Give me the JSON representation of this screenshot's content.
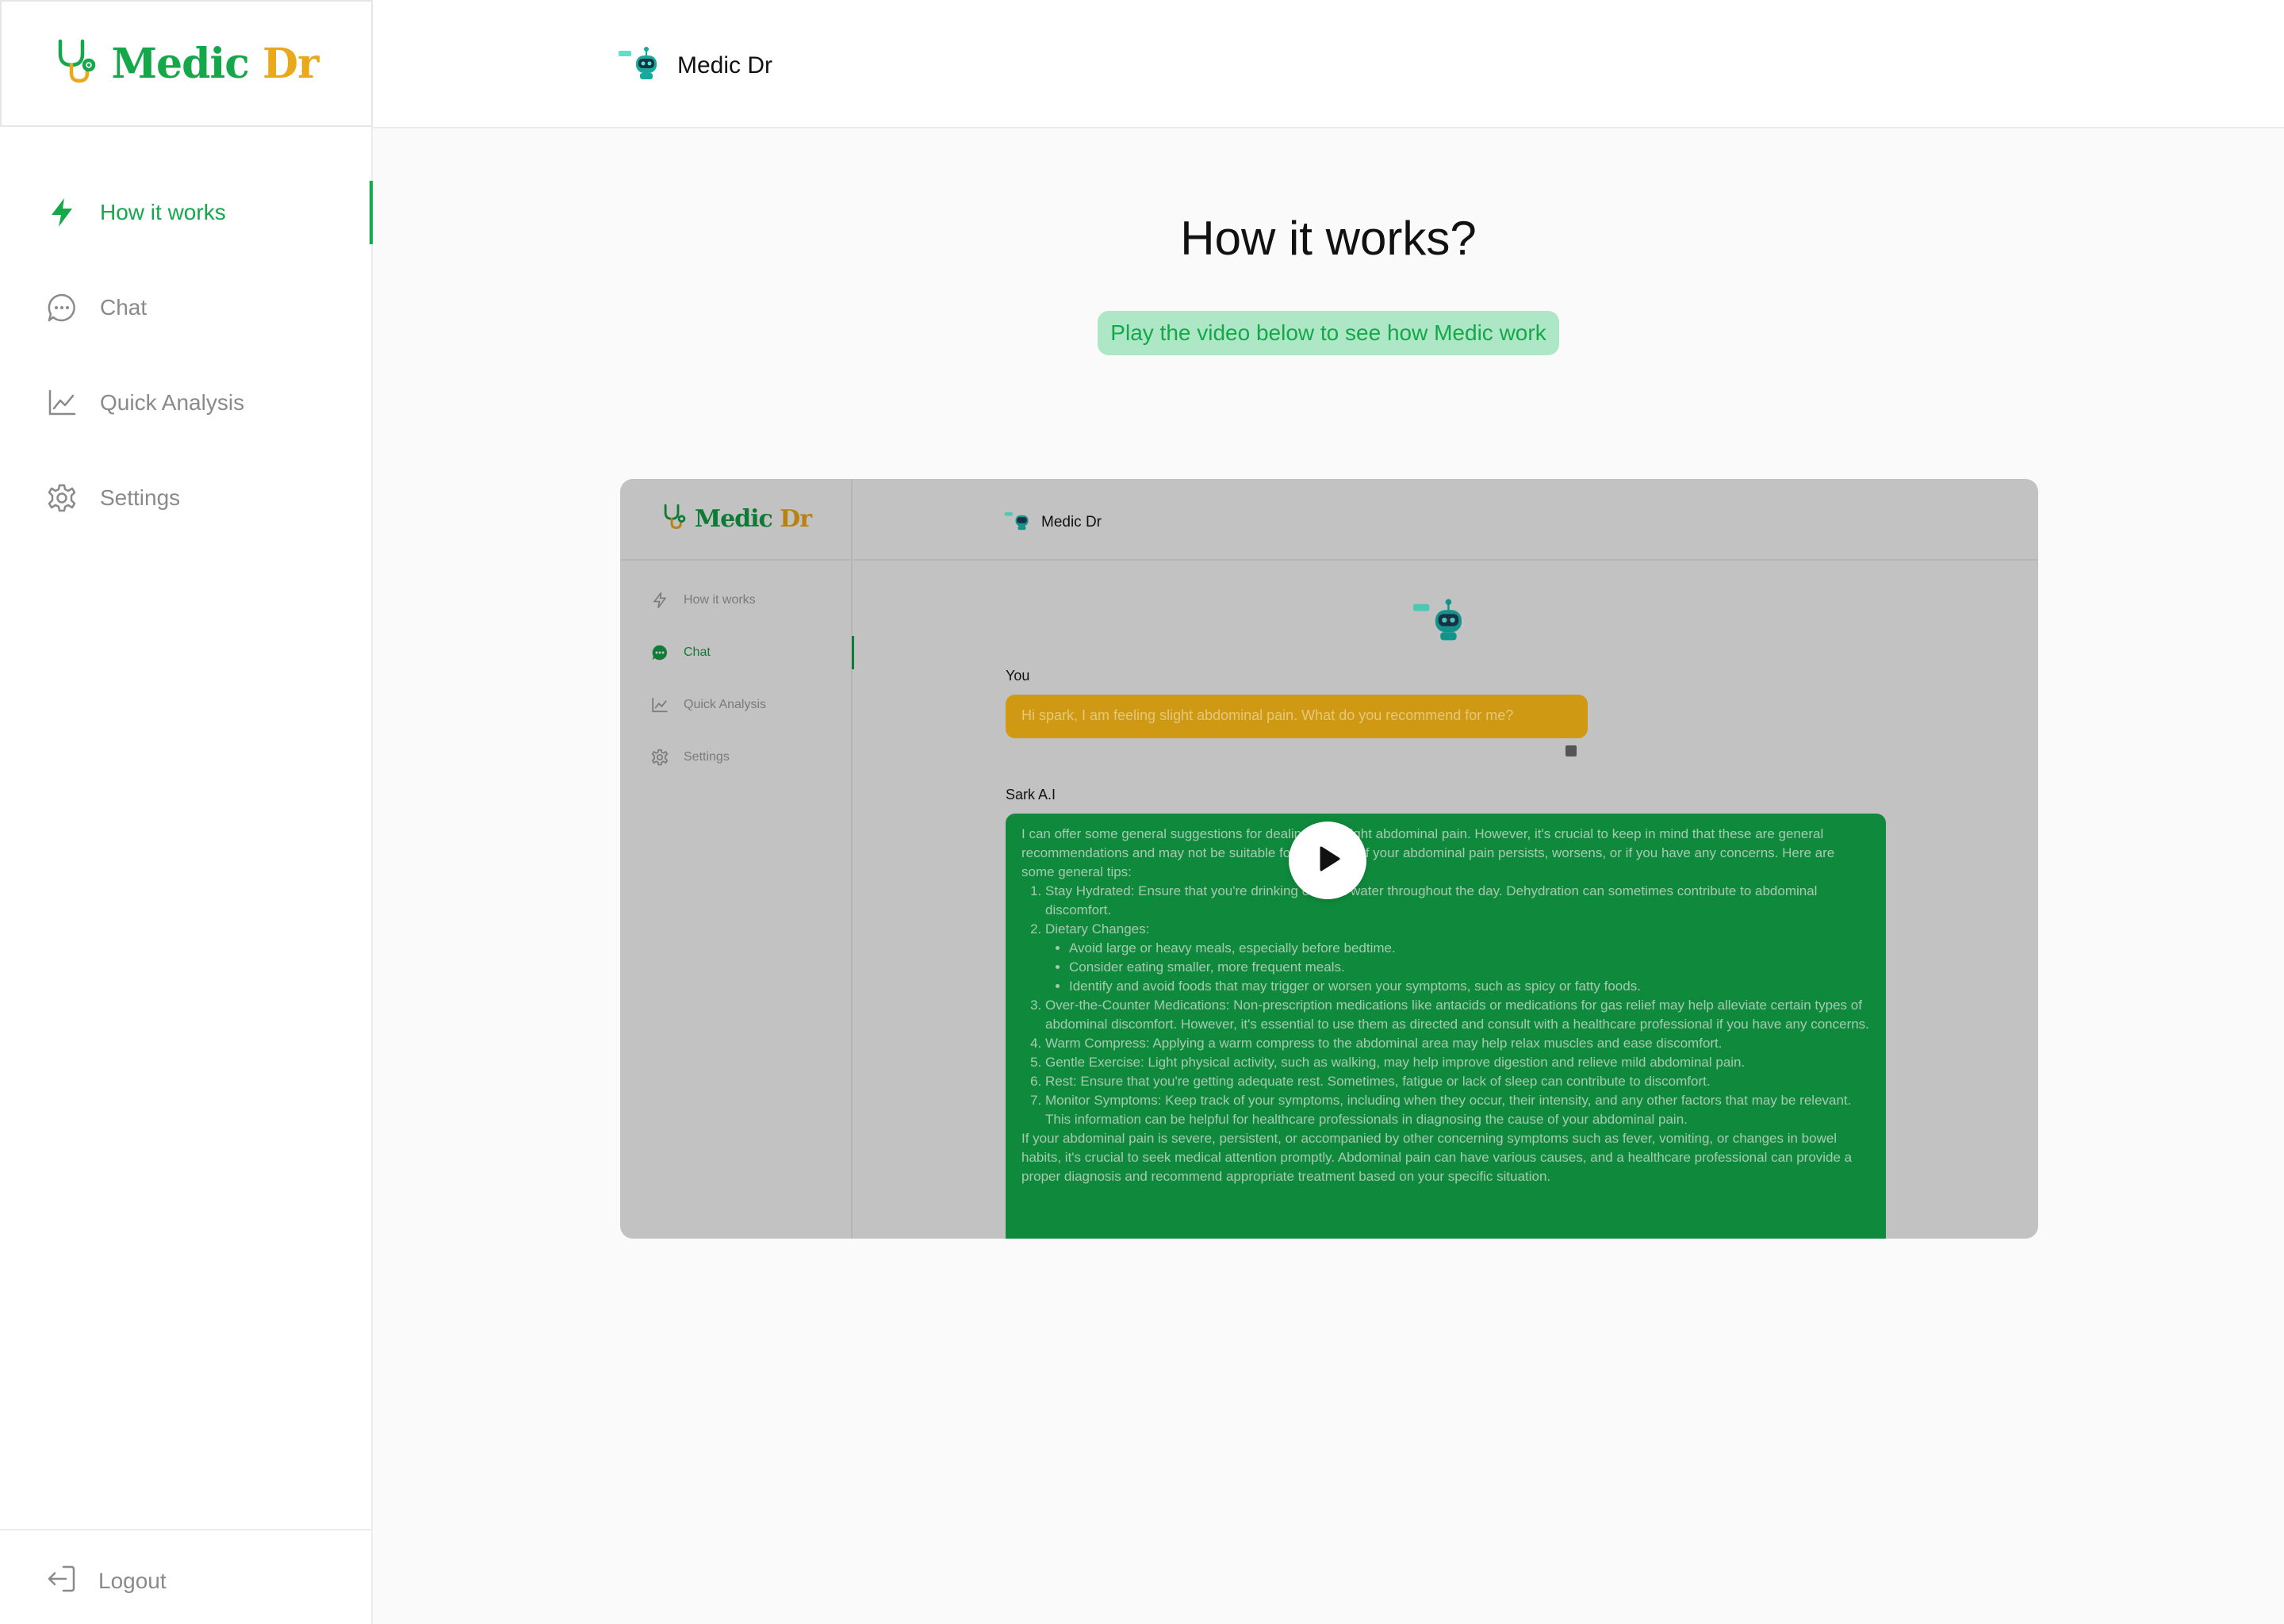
{
  "brand": {
    "part1": "Medic",
    "part2": "Dr",
    "header_name": "Medic Dr"
  },
  "sidebar": {
    "items": [
      {
        "label": "How it works",
        "icon": "lightning-icon",
        "active": true
      },
      {
        "label": "Chat",
        "icon": "chat-bubble-icon",
        "active": false
      },
      {
        "label": "Quick Analysis",
        "icon": "chart-line-icon",
        "active": false
      },
      {
        "label": "Settings",
        "icon": "gear-icon",
        "active": false
      }
    ],
    "logout_label": "Logout"
  },
  "main": {
    "title": "How it works?",
    "subtitle": "Play the video below to see how Medic work"
  },
  "video": {
    "sidebar_items": [
      "How it works",
      "Chat",
      "Quick Analysis",
      "Settings"
    ],
    "header_name": "Medic Dr",
    "you_label": "You",
    "user_message": "Hi spark, I am feeling slight abdominal pain. What do you recommend for me?",
    "ai_label": "Sark A.I",
    "ai_intro": "I can offer some general suggestions for dealing with slight abdominal pain. However, it's crucial to keep in mind that these are general recommendations and may not be suitable for everyone. If your abdominal pain persists, worsens, or if you have any concerns. Here are some general tips:",
    "ai_steps": [
      "Stay Hydrated: Ensure that you're drinking enough water throughout the day. Dehydration can sometimes contribute to abdominal discomfort.",
      "Dietary Changes:",
      "Over-the-Counter Medications: Non-prescription medications like antacids or medications for gas relief may help alleviate certain types of abdominal discomfort. However, it's essential to use them as directed and consult with a healthcare professional if you have any concerns.",
      "Warm Compress: Applying a warm compress to the abdominal area may help relax muscles and ease discomfort.",
      "Gentle Exercise: Light physical activity, such as walking, may help improve digestion and relieve mild abdominal pain.",
      "Rest: Ensure that you're getting adequate rest. Sometimes, fatigue or lack of sleep can contribute to discomfort.",
      "Monitor Symptoms: Keep track of your symptoms, including when they occur, their intensity, and any other factors that may be relevant. This information can be helpful for healthcare professionals in diagnosing the cause of your abdominal pain."
    ],
    "diet_bullets": [
      "Avoid large or heavy meals, especially before bedtime.",
      "Consider eating smaller, more frequent meals.",
      "Identify and avoid foods that may trigger or worsen your symptoms, such as spicy or fatty foods."
    ],
    "ai_outro": "If your abdominal pain is severe, persistent, or accompanied by other concerning symptoms such as fever, vomiting, or changes in bowel habits, it's crucial to seek medical attention promptly. Abdominal pain can have various causes, and a healthcare professional can provide a proper diagnosis and recommend appropriate treatment based on your specific situation."
  },
  "colors": {
    "accent": "#14a84a",
    "brand_yellow": "#e9a91b",
    "pill_bg": "#aee7c5",
    "user_bubble": "#cf9914",
    "ai_bubble": "#0f8a3c"
  }
}
